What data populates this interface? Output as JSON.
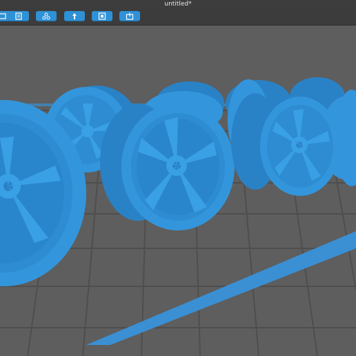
{
  "window": {
    "title": "untitled*"
  },
  "toolbar": {
    "buttons": [
      {
        "icon": "import-icon"
      },
      {
        "icon": "document-icon"
      },
      {
        "icon": "arrange-icon"
      },
      {
        "icon": "support-icon"
      },
      {
        "icon": "slice-frame-icon"
      },
      {
        "icon": "export-icon"
      }
    ]
  },
  "scene": {
    "model_color": "#3396dc",
    "bed_color": "#5e5e5e",
    "grid_color": "#505050",
    "bed_edge_color": "#3b8fd3",
    "wheel_count": 8
  },
  "colors": {
    "toolbar_bg": "#3c3c3c",
    "titlebar_bg": "#3d3d3d",
    "button_accent": "#2f91d6"
  }
}
